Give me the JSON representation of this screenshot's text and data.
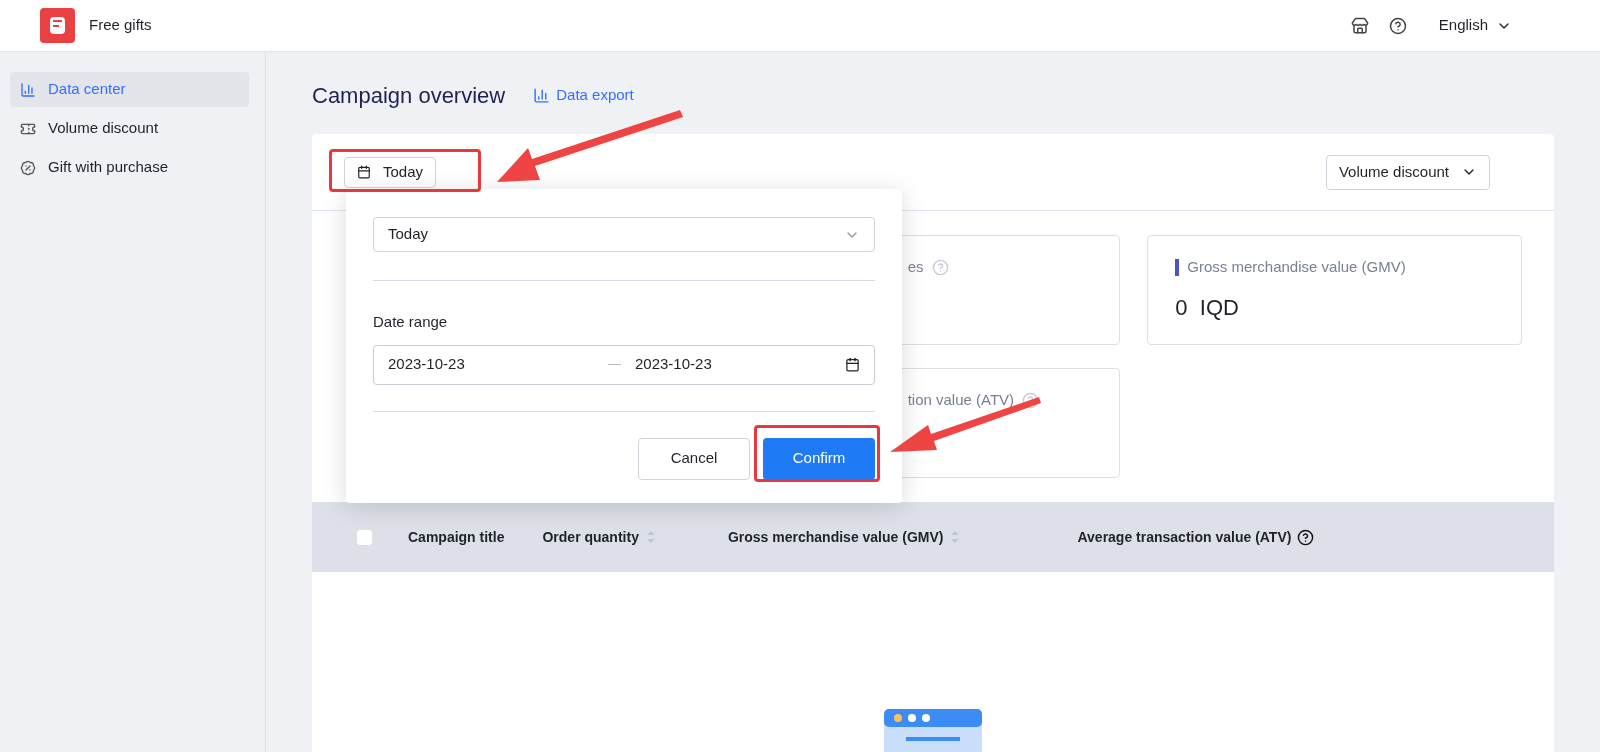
{
  "header": {
    "app_name": "Free gifts",
    "language": "English"
  },
  "sidebar": {
    "items": [
      {
        "label": "Data center",
        "selected": true
      },
      {
        "label": "Volume discount",
        "selected": false
      },
      {
        "label": "Gift with purchase",
        "selected": false
      }
    ]
  },
  "page": {
    "title": "Campaign overview",
    "export_link": "Data export"
  },
  "filters": {
    "date_button": "Today",
    "campaign_type": "Volume discount"
  },
  "stats": [
    {
      "label": "es",
      "help": true,
      "marker": false
    },
    {
      "label": "Gross merchandise value (GMV)",
      "value": "0  IQD",
      "help": false,
      "marker": true
    },
    {
      "label": "tion value (ATV)",
      "help": true,
      "marker": false
    }
  ],
  "table": {
    "select_all": {
      "checked": false
    },
    "columns": [
      {
        "label": "Campaign title",
        "sortable": false,
        "help": false
      },
      {
        "label": "Order quantity",
        "sortable": true,
        "help": false
      },
      {
        "label": "Gross merchandise value (GMV)",
        "sortable": true,
        "help": false
      },
      {
        "label": "Average transaction value (ATV)",
        "sortable": false,
        "help": true
      }
    ]
  },
  "date_popup": {
    "preset": "Today",
    "range_label": "Date range",
    "start_date": "2023-10-23",
    "end_date": "2023-10-23",
    "buttons": [
      {
        "label": "Cancel",
        "kind": "secondary"
      },
      {
        "label": "Confirm",
        "kind": "primary"
      }
    ]
  }
}
